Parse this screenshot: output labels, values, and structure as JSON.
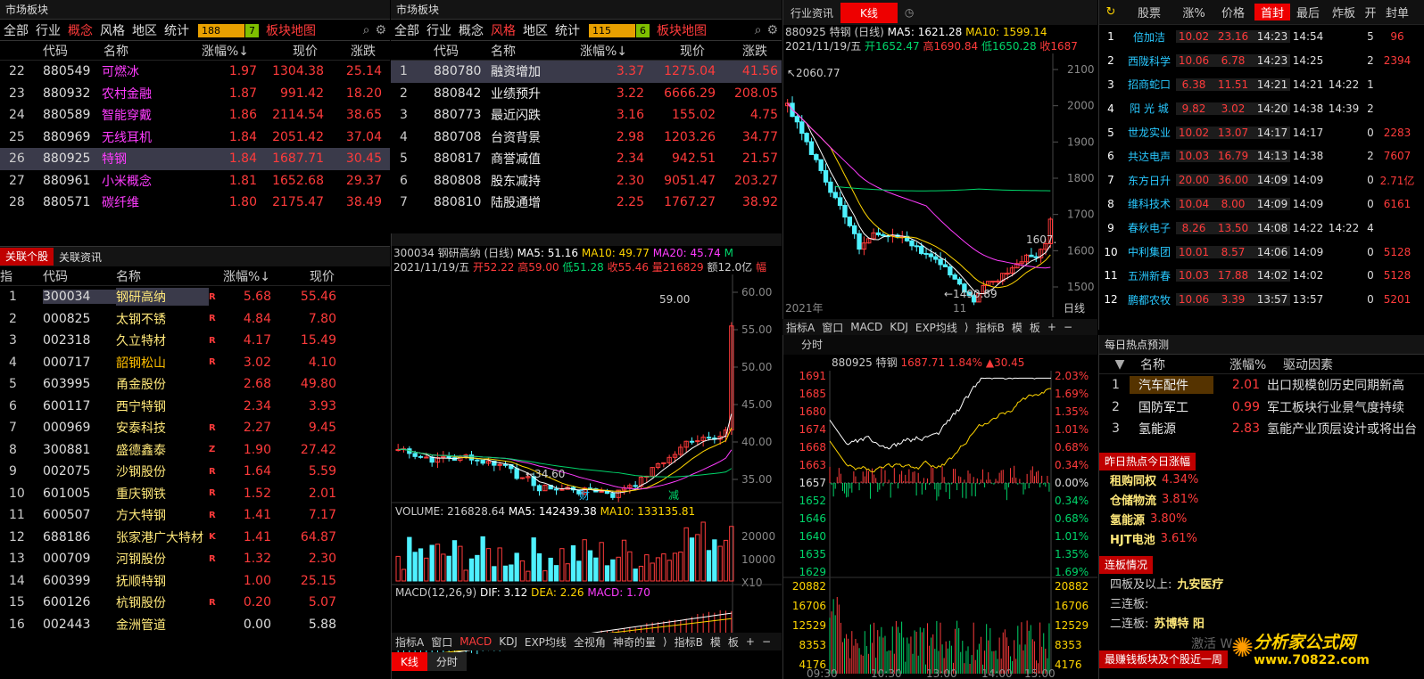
{
  "p1": {
    "title": "市场板块",
    "tabs": [
      "全部",
      "行业",
      "概念",
      "风格",
      "地区",
      "统计"
    ],
    "active_tab": "概念",
    "bar": "188",
    "bar2": "7",
    "map": "板块地图",
    "hdr": [
      "代码",
      "名称",
      "涨幅%↓",
      "现价",
      "涨跌"
    ],
    "rows": [
      [
        "22",
        "880549",
        "可燃冰",
        "1.97",
        "1304.38",
        "25.14"
      ],
      [
        "23",
        "880932",
        "农村金融",
        "1.87",
        "991.42",
        "18.20"
      ],
      [
        "24",
        "880589",
        "智能穿戴",
        "1.86",
        "2114.54",
        "38.65"
      ],
      [
        "25",
        "880969",
        "无线耳机",
        "1.84",
        "2051.42",
        "37.04"
      ],
      [
        "26",
        "880925",
        "特钢",
        "1.84",
        "1687.71",
        "30.45"
      ],
      [
        "27",
        "880961",
        "小米概念",
        "1.81",
        "1652.68",
        "29.37"
      ],
      [
        "28",
        "880571",
        "碳纤维",
        "1.80",
        "2175.47",
        "38.49"
      ]
    ]
  },
  "p2": {
    "title": "市场板块",
    "tabs": [
      "全部",
      "行业",
      "概念",
      "风格",
      "地区",
      "统计"
    ],
    "active_tab": "风格",
    "bar": "115",
    "bar2": "6",
    "map": "板块地图",
    "hdr": [
      "代码",
      "名称",
      "涨幅%↓",
      "现价",
      "涨跌"
    ],
    "rows": [
      [
        "1",
        "880780",
        "融资增加",
        "3.37",
        "1275.04",
        "41.56"
      ],
      [
        "2",
        "880842",
        "业绩预升",
        "3.22",
        "6666.29",
        "208.05"
      ],
      [
        "3",
        "880773",
        "最近闪跌",
        "3.16",
        "155.02",
        "4.75"
      ],
      [
        "4",
        "880708",
        "台资背景",
        "2.98",
        "1203.26",
        "34.77"
      ],
      [
        "5",
        "880817",
        "商誉减值",
        "2.34",
        "942.51",
        "21.57"
      ],
      [
        "6",
        "880808",
        "股东减持",
        "2.30",
        "9051.47",
        "203.27"
      ],
      [
        "7",
        "880810",
        "陆股通增",
        "2.25",
        "1767.27",
        "38.92"
      ]
    ]
  },
  "p3": {
    "tab1": "关联个股",
    "tab2": "关联资讯",
    "hdr": [
      "指",
      "代码",
      "名称",
      "涨幅%↓",
      "现价"
    ],
    "rows": [
      [
        "1",
        "300034",
        "钢研高纳",
        "R",
        "5.68",
        "55.46"
      ],
      [
        "2",
        "000825",
        "太钢不锈",
        "R",
        "4.84",
        "7.80"
      ],
      [
        "3",
        "002318",
        "久立特材",
        "R",
        "4.17",
        "15.49"
      ],
      [
        "4",
        "000717",
        "韶钢松山",
        "R",
        "3.02",
        "4.10"
      ],
      [
        "5",
        "603995",
        "甬金股份",
        "",
        "2.68",
        "49.80"
      ],
      [
        "6",
        "600117",
        "西宁特钢",
        "",
        "2.34",
        "3.93"
      ],
      [
        "7",
        "000969",
        "安泰科技",
        "R",
        "2.27",
        "9.45"
      ],
      [
        "8",
        "300881",
        "盛德鑫泰",
        "Z",
        "1.90",
        "27.42"
      ],
      [
        "9",
        "002075",
        "沙钢股份",
        "R",
        "1.64",
        "5.59"
      ],
      [
        "10",
        "601005",
        "重庆钢铁",
        "R",
        "1.52",
        "2.01"
      ],
      [
        "11",
        "600507",
        "方大特钢",
        "R",
        "1.41",
        "7.17"
      ],
      [
        "12",
        "688186",
        "张家港广大特材",
        "K",
        "1.41",
        "64.87"
      ],
      [
        "13",
        "000709",
        "河钢股份",
        "R",
        "1.32",
        "2.30"
      ],
      [
        "14",
        "600399",
        "抚顺特钢",
        "",
        "1.00",
        "25.15"
      ],
      [
        "15",
        "600126",
        "杭钢股份",
        "R",
        "0.20",
        "5.07"
      ],
      [
        "16",
        "002443",
        "金洲管道",
        "",
        "0.00",
        "5.88"
      ]
    ]
  },
  "k1": {
    "title": "300034 钢研高纳 (日线)",
    "ma5": "MA5: 51.16",
    "ma10": "MA10: 49.77",
    "ma20": "MA20: 45.74",
    "ma": "M",
    "date": "2021/11/19/五",
    "open": "开52.22",
    "high": "高59.00",
    "low": "低51.28",
    "close": "收55.46",
    "vol": "量216829",
    "amt": "额12.0亿",
    "fu": "幅",
    "hi_label": "59.00",
    "lo_label": "34.60",
    "cai": "财",
    "jian": "减",
    "yt": [
      "60.00",
      "55.00",
      "50.00",
      "45.00",
      "40.00",
      "35.00"
    ],
    "volume": "VOLUME: 216828.64",
    "vma5": "MA5: 142439.38",
    "vma10": "MA10: 133135.81",
    "vyt": [
      "20000",
      "10000",
      "X10"
    ],
    "macd": "MACD(12,26,9)",
    "dif": "DIF: 3.12",
    "dea": "DEA: 2.26",
    "macdv": "MACD: 1.70",
    "xt": [
      "2021年",
      "11"
    ],
    "xunit": "日线",
    "bottom": [
      "指标A",
      "窗口",
      "MACD",
      "KDJ",
      "EXP均线",
      "全视角",
      "神奇的量",
      "⟩",
      "指标B",
      "模",
      "板",
      "+",
      "−"
    ],
    "btabs": [
      "K线",
      "分时"
    ]
  },
  "k2": {
    "tab1": "行业资讯",
    "tab2": "K线",
    "title": "880925 特钢 (日线)",
    "ma5": "MA5: 1621.28",
    "ma10": "MA10: 1599.14",
    "date": "2021/11/19/五",
    "open": "开1652.47",
    "high": "高1690.84",
    "low": "低1650.28",
    "close": "收1687",
    "hi": "2060.77",
    "lo": "1490.89",
    "cur": "1607.",
    "yt": [
      "2100",
      "2000",
      "1900",
      "1800",
      "1700",
      "1600",
      "1500"
    ],
    "xt": [
      "2021年",
      "11"
    ],
    "xunit": "日线",
    "ind": [
      "指标A",
      "窗口",
      "MACD",
      "KDJ",
      "EXP均线",
      "⟩",
      "指标B",
      "模",
      "板",
      "+",
      "−"
    ]
  },
  "fs": {
    "tab": "分时",
    "title": "880925 特钢",
    "price": "1687.71",
    "pct": "1.84%",
    "chg": "▲30.45",
    "lt": [
      "1691",
      "1685",
      "1680",
      "1674",
      "1668",
      "1663",
      "1657",
      "1652",
      "1646",
      "1640",
      "1635",
      "1629"
    ],
    "rt": [
      "2.03%",
      "1.69%",
      "1.35%",
      "1.01%",
      "0.68%",
      "0.34%",
      "0.00%",
      "0.34%",
      "0.68%",
      "1.01%",
      "1.35%",
      "1.69%"
    ],
    "vl": [
      "20882",
      "16706",
      "12529",
      "8353",
      "4176"
    ],
    "xt": [
      "09:30",
      "10:30",
      "13:00",
      "14:00",
      "15:00"
    ]
  },
  "st": {
    "hdr": [
      "股票",
      "涨%",
      "价格",
      "首封",
      "最后",
      "炸板",
      "开",
      "封单"
    ],
    "rows": [
      [
        "1",
        "倍加洁",
        "10.02",
        "23.16",
        "14:23",
        "14:54",
        "",
        "5",
        "96"
      ],
      [
        "2",
        "西陇科学",
        "10.06",
        "6.78",
        "14:23",
        "14:25",
        "",
        "2",
        "2394"
      ],
      [
        "3",
        "招商蛇口",
        "6.38",
        "11.51",
        "14:21",
        "14:21",
        "14:22",
        "1",
        ""
      ],
      [
        "4",
        "阳 光 城",
        "9.82",
        "3.02",
        "14:20",
        "14:38",
        "14:39",
        "2",
        ""
      ],
      [
        "5",
        "世龙实业",
        "10.02",
        "13.07",
        "14:17",
        "14:17",
        "",
        "0",
        "2283"
      ],
      [
        "6",
        "共达电声",
        "10.03",
        "16.79",
        "14:13",
        "14:38",
        "",
        "2",
        "7607"
      ],
      [
        "7",
        "东方日升",
        "20.00",
        "36.00",
        "14:09",
        "14:09",
        "",
        "0",
        "2.71亿"
      ],
      [
        "8",
        "维科技术",
        "10.04",
        "8.00",
        "14:09",
        "14:09",
        "",
        "0",
        "6161"
      ],
      [
        "9",
        "春秋电子",
        "8.26",
        "13.50",
        "14:08",
        "14:22",
        "14:22",
        "4",
        ""
      ],
      [
        "10",
        "中利集团",
        "10.01",
        "8.57",
        "14:06",
        "14:09",
        "",
        "0",
        "5128"
      ],
      [
        "11",
        "五洲新春",
        "10.03",
        "17.88",
        "14:02",
        "14:02",
        "",
        "0",
        "5128"
      ],
      [
        "12",
        "鹏都农牧",
        "10.06",
        "3.39",
        "13:57",
        "13:57",
        "",
        "0",
        "5201"
      ]
    ]
  },
  "hot": {
    "title": "每日热点预测",
    "hdr": [
      "名称",
      "涨幅%",
      "驱动因素"
    ],
    "rows": [
      [
        "1",
        "汽车配件",
        "2.01",
        "出口规模创历史同期新高"
      ],
      [
        "2",
        "国防军工",
        "0.99",
        "军工板块行业景气度持续"
      ],
      [
        "3",
        "氢能源",
        "2.83",
        "氢能产业顶层设计或将出台"
      ]
    ],
    "y_title": "昨日热点今日涨幅",
    "y_rows": [
      [
        "租购同权",
        "4.34%"
      ],
      [
        "仓储物流",
        "3.81%"
      ],
      [
        "氢能源",
        "3.80%"
      ],
      [
        "HJT电池",
        "3.61%"
      ]
    ],
    "lb_title": "连板情况",
    "lb_rows": [
      [
        "四板及以上:",
        "九安医疗"
      ],
      [
        "三连板:",
        ""
      ],
      [
        "二连板:",
        "苏博特  阳"
      ]
    ],
    "footer": "最赚钱板块及个股近一周",
    "logo": "分析家公式网",
    "logo_url": "www.70822.com",
    "activate": "激活 W"
  }
}
